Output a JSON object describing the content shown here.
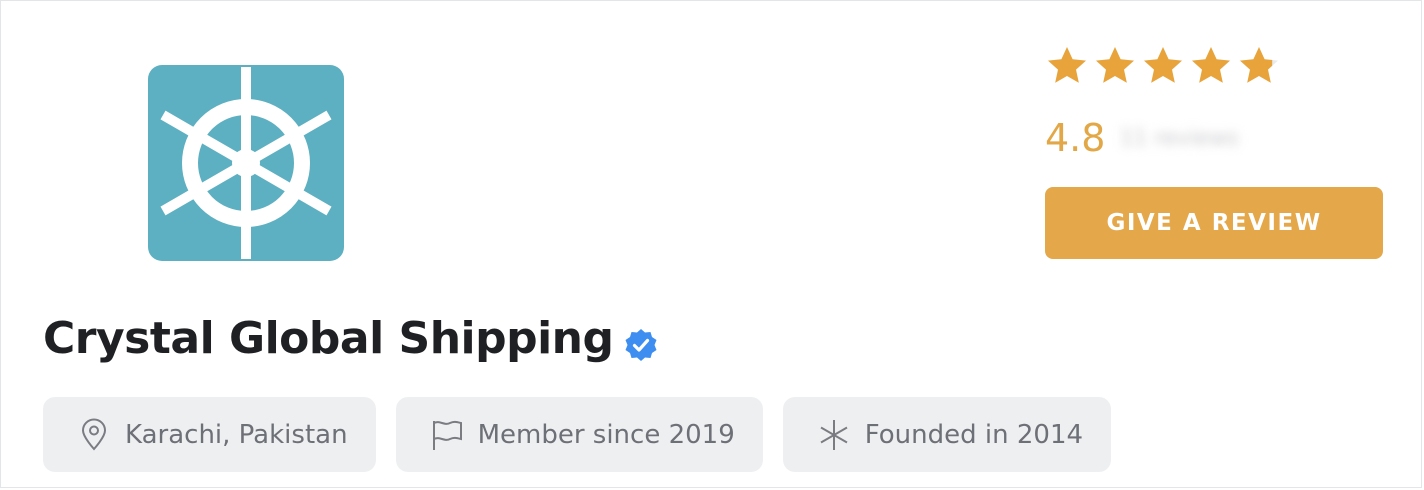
{
  "company": {
    "name": "Crystal Global Shipping",
    "verified": true,
    "logo_icon": "ship-wheel-icon",
    "logo_color": "#5db0c1"
  },
  "rating": {
    "value": 4.8,
    "display": "4.8",
    "stars_filled_fraction": 0.96,
    "star_color": "#e8a43b",
    "reviews_label": "11 reviews"
  },
  "actions": {
    "give_review_label": "GIVE A REVIEW",
    "accent": "#e4a749"
  },
  "chips": [
    {
      "icon": "location-pin-icon",
      "label": "Karachi, Pakistan"
    },
    {
      "icon": "flag-icon",
      "label": "Member since 2019"
    },
    {
      "icon": "asterisk-icon",
      "label": "Founded in 2014"
    }
  ]
}
